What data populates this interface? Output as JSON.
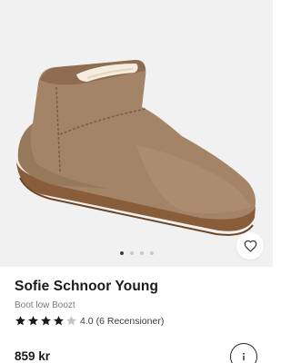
{
  "product": {
    "brand": "Sofie Schnoor Young",
    "subtitle": "Boot low Boozt",
    "rating_value": "4.0",
    "review_count": "(6 Recensioner)",
    "stars": 4,
    "stars_max": 5,
    "price": "859 kr"
  },
  "gallery": {
    "image_count": 4,
    "active_index": 0
  },
  "icons": {
    "favorite": "heart-icon",
    "info": "info-icon",
    "star": "star-icon"
  },
  "colors": {
    "star_filled": "#1a1a1a",
    "star_empty": "#c4c4c4",
    "dot_active": "#3c3c3c",
    "dot_inactive": "#c8c8c8"
  }
}
